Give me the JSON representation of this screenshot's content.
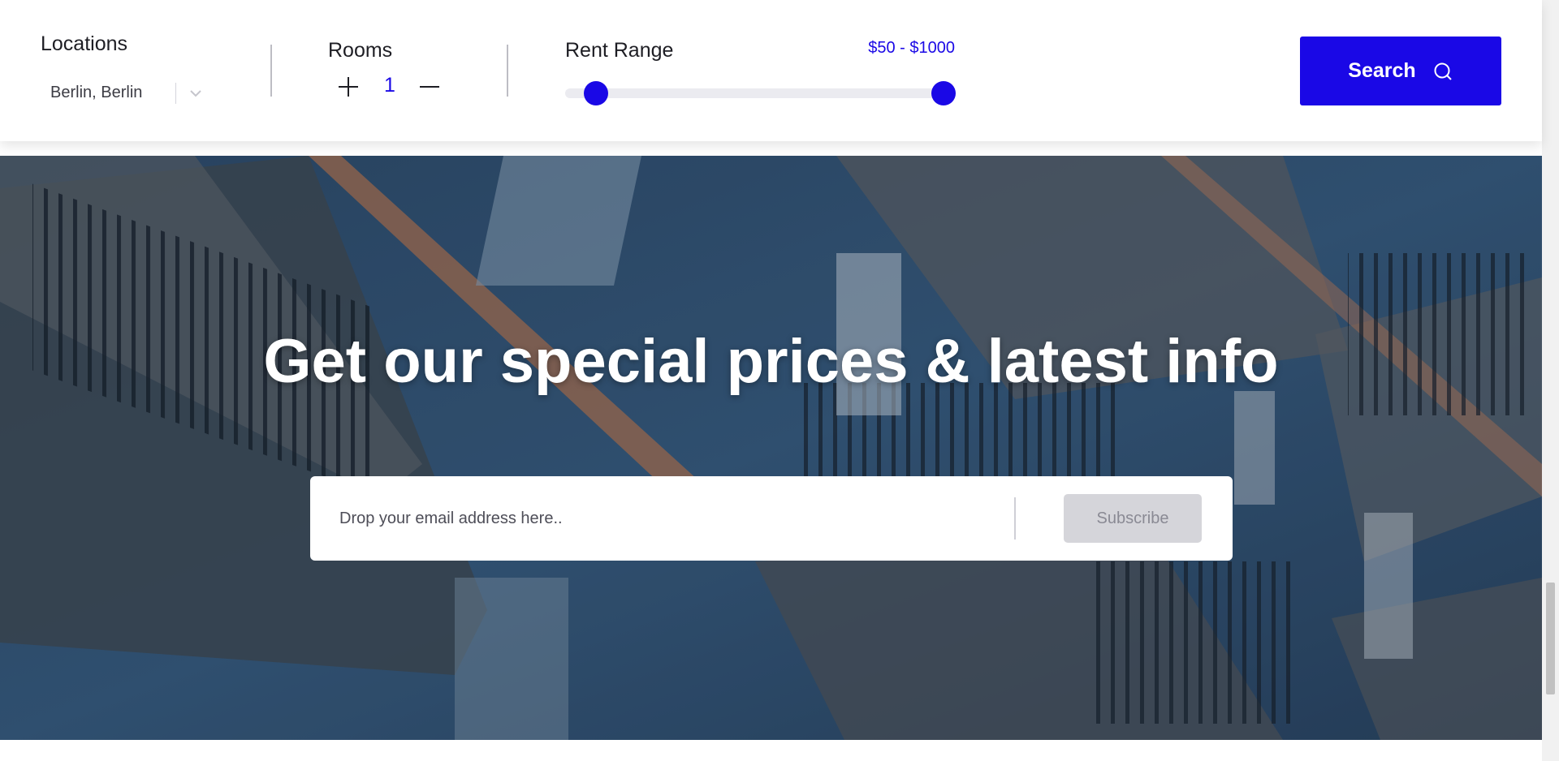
{
  "search": {
    "locations_label": "Locations",
    "location_value": "Berlin, Berlin",
    "rooms_label": "Rooms",
    "rooms_value": "1",
    "rent_label": "Rent Range",
    "rent_value": "$50 - $1000",
    "rent_range": {
      "min_fraction": 0.08,
      "max_fraction": 0.97
    },
    "search_button": "Search",
    "icons": {
      "location_dropdown": "chevron-down-icon",
      "rooms_increment": "plus-icon",
      "rooms_decrement": "minus-icon",
      "search": "search-icon"
    }
  },
  "newsletter": {
    "title": "Get our special prices & latest info",
    "email_placeholder": "Drop your email address here..",
    "subscribe_button": "Subscribe"
  },
  "colors": {
    "accent": "#1a08e6",
    "subscribe_disabled_bg": "#d5d5da",
    "hero_tint": "#2c4a69"
  }
}
